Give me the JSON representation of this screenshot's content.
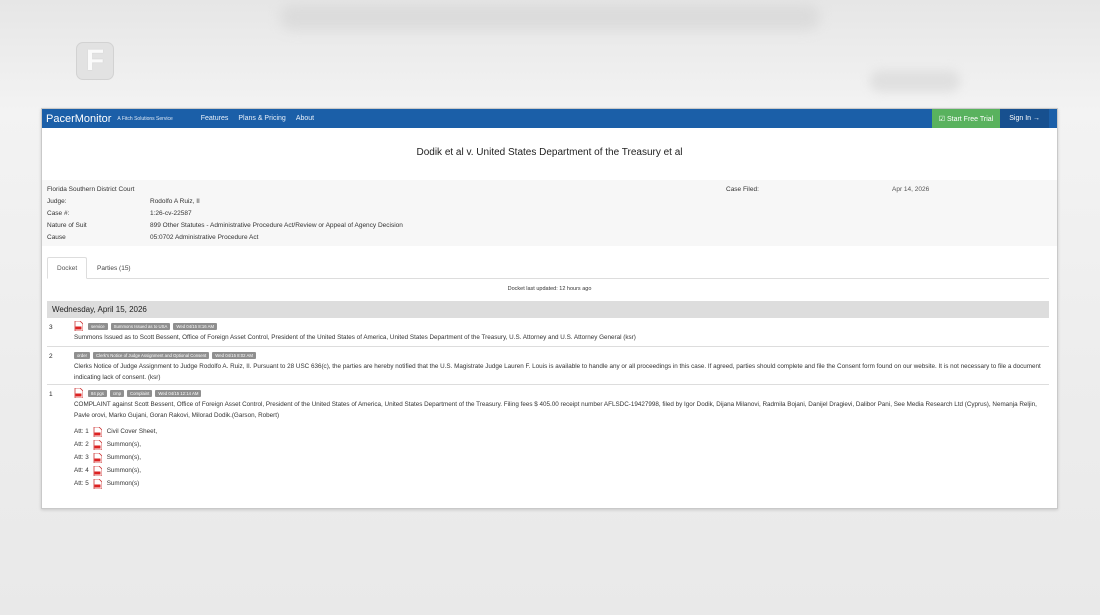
{
  "navbar": {
    "brand": "PacerMonitor",
    "tagline": "A Fitch Solutions Service",
    "links": [
      "Features",
      "Plans & Pricing",
      "About"
    ],
    "trial_label": "☑ Start Free Trial",
    "signin_label": "Sign In →"
  },
  "case": {
    "title": "Dodik et al v. United States Department of the Treasury et al",
    "court": "Florida Southern District Court",
    "filed_label": "Case Filed:",
    "filed_value": "Apr 14, 2026",
    "fields": [
      {
        "label": "Judge:",
        "value": "Rodolfo A Ruiz, II"
      },
      {
        "label": "Case #:",
        "value": "1:26-cv-22587"
      },
      {
        "label": "Nature of Suit",
        "value": "899 Other Statutes - Administrative Procedure Act/Review or Appeal of Agency Decision"
      },
      {
        "label": "Cause",
        "value": "05:0702 Administrative Procedure Act"
      }
    ]
  },
  "tabs": [
    {
      "label": "Docket",
      "active": true
    },
    {
      "label": "Parties (15)",
      "active": false
    }
  ],
  "docket": {
    "updated": "Docket last updated: 12 hours ago",
    "date_heading": "Wednesday, April 15, 2026",
    "entries": [
      {
        "num": "3",
        "tags": [
          "service",
          "Summons Issued as to USA",
          "Wed 04/15 8:16 AM"
        ],
        "text": "Summons Issued as to Scott Bessent, Office of Foreign Asset Control, President of the United States of America, United States Department of the Treasury, U.S. Attorney and U.S. Attorney General (ksr)"
      },
      {
        "num": "2",
        "tags": [
          "order",
          "Clerk's Notice of Judge Assignment and Optional Consent",
          "Wed 04/15 8:02 AM"
        ],
        "text": "Clerks Notice of Judge Assignment to Judge Rodolfo A. Ruiz, II. Pursuant to 28 USC 636(c), the parties are hereby notified that the U.S. Magistrate Judge Lauren F. Louis is available to handle any or all proceedings in this case. If agreed, parties should complete and file the Consent form found on our website. It is not necessary to file a document indicating lack of consent. (ksr)"
      },
      {
        "num": "1",
        "tags": [
          "84 pgs",
          "cmp",
          "Complaint",
          "Wed 04/15 12:14 AM"
        ],
        "text": "COMPLAINT against Scott Bessent, Office of Foreign Asset Control, President of the United States of America, United States Department of the Treasury. Filing fees $ 405.00 receipt number AFLSDC-19427998, filed by Igor Dodik, Dijana Milanovi, Radmila Bojani, Danijel Dragievi, Dalibor Pani, See Media Research Ltd (Cyprus), Nemanja Reljin, Pavle orovi, Marko Gujani, Goran Rakovi, Milorad Dodik.(Garson, Robert)",
        "attachments": [
          {
            "label": "Att: 1",
            "desc": "Civil Cover Sheet,"
          },
          {
            "label": "Att: 2",
            "desc": "Summon(s),"
          },
          {
            "label": "Att: 3",
            "desc": "Summon(s),"
          },
          {
            "label": "Att: 4",
            "desc": "Summon(s),"
          },
          {
            "label": "Att: 5",
            "desc": "Summon(s)"
          }
        ]
      }
    ]
  }
}
